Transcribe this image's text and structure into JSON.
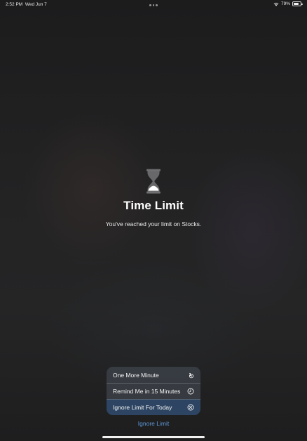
{
  "status_bar": {
    "time": "2:52 PM",
    "date": "Wed Jun 7",
    "battery_percent": "79%",
    "battery_level": 0.79,
    "icons": [
      "multitasking-dots-icon",
      "wifi-icon",
      "battery-icon"
    ]
  },
  "main": {
    "icon": "hourglass-icon",
    "title": "Time Limit",
    "subtitle": "You've reached your limit on Stocks."
  },
  "menu": {
    "items": [
      {
        "label": "One More Minute",
        "icon": "one-minute-icon"
      },
      {
        "label": "Remind Me in 15 Minutes",
        "icon": "clock-icon"
      },
      {
        "label": "Ignore Limit For Today",
        "icon": "x-circle-icon"
      }
    ],
    "highlighted_index": 2
  },
  "ignore_limit": "Ignore Limit",
  "colors": {
    "link": "#5d96d6",
    "highlight": "#2c4868",
    "background": "#232324"
  }
}
